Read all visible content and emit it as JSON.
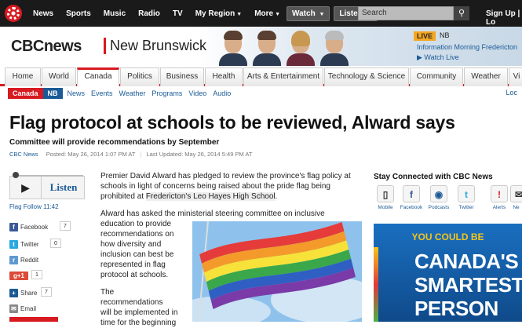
{
  "topbar": {
    "nav": [
      "News",
      "Sports",
      "Music",
      "Radio",
      "TV",
      "My Region",
      "More"
    ],
    "watch": "Watch",
    "listen": "Listen",
    "search_placeholder": "Search",
    "signup": "Sign Up | Lo"
  },
  "banner": {
    "logo": "CBCnews",
    "region": "New Brunswick",
    "live_badge": "LIVE",
    "live_region": "NB",
    "live_show": "Information Morning Fredericton",
    "watch_live": "Watch Live"
  },
  "sections": [
    "Home",
    "World",
    "Canada",
    "Politics",
    "Business",
    "Health",
    "Arts & Entertainment",
    "Technology & Science",
    "Community",
    "Weather",
    "Vi"
  ],
  "subnav": {
    "crumb1": "Canada",
    "crumb2": "NB",
    "links": [
      "News",
      "Events",
      "Weather",
      "Programs",
      "Video",
      "Audio"
    ],
    "right": "Loc"
  },
  "article": {
    "headline": "Flag protocol at schools to be reviewed, Alward says",
    "subhead": "Committee will provide recommendations by September",
    "source": "CBC News",
    "posted": "Posted: May 26, 2014 1:07 PM AT",
    "updated": "Last Updated: May 26, 2014 5:49 PM AT",
    "p1_lines": [
      "Premier David Alward has pledged to review the province's flag policy at",
      "schools in light of concerns being raised about the pride flag being",
      "prohibited at"
    ],
    "p1_link": "Fredericton's Leo Hayes High School",
    "p1_end": ".",
    "p2_lines": [
      "Alward has asked the ministerial steering committee on inclusive",
      "education to provide",
      "recommendations on",
      "how diversity and",
      "inclusion can best be",
      "represented in flag",
      "protocol at schools."
    ],
    "p3_lines": [
      "The",
      "recommendations",
      "will be implemented in",
      "time for the beginning"
    ]
  },
  "listen": {
    "label": "Listen",
    "caption": "Flag Follow 11:42"
  },
  "share": [
    {
      "label": "Facebook",
      "count": "7",
      "icon": "facebook-icon",
      "color": "#3b5998",
      "glyph": "f"
    },
    {
      "label": "Twitter",
      "count": "0",
      "icon": "twitter-icon",
      "color": "#2aa9e0",
      "glyph": "t"
    },
    {
      "label": "Reddit",
      "count": "",
      "icon": "reddit-icon",
      "color": "#5f99cf",
      "glyph": "r"
    },
    {
      "label": "g+1",
      "count": "1",
      "icon": "google-plus-icon",
      "color": "#dd4b39",
      "glyph": "g"
    },
    {
      "label": "Share",
      "count": "7",
      "icon": "share-icon",
      "color": "#1a5a96",
      "glyph": "s"
    },
    {
      "label": "Email",
      "count": "",
      "icon": "email-icon",
      "color": "#888",
      "glyph": "✉"
    }
  ],
  "sidebar": {
    "title": "Stay Connected with CBC News",
    "items": [
      {
        "label": "Mobile",
        "icon": "mobile-icon",
        "glyph": "▯"
      },
      {
        "label": "Facebook",
        "icon": "facebook-icon",
        "glyph": "f"
      },
      {
        "label": "Podcasts",
        "icon": "podcast-icon",
        "glyph": "◉"
      },
      {
        "label": "Twitter",
        "icon": "twitter-icon",
        "glyph": "t"
      },
      {
        "label": "Alerts",
        "icon": "alert-icon",
        "glyph": "!"
      },
      {
        "label": "Ne",
        "icon": "newsletter-icon",
        "glyph": "✉"
      }
    ]
  },
  "ad": {
    "line1": "YOU COULD BE",
    "line2": "CANADA'S",
    "line3": "SMARTEST",
    "line4": "PERSON"
  },
  "colors": {
    "brand_red": "#d71920",
    "link_blue": "#1a5a96",
    "live_orange": "#f5a623"
  }
}
